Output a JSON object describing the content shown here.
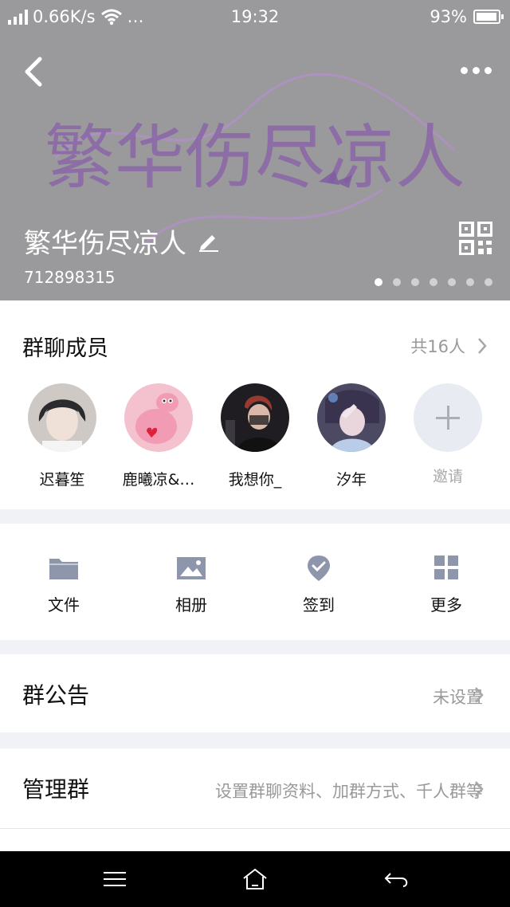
{
  "status_bar": {
    "speed": "0.66K/s",
    "more": "…",
    "time": "19:32",
    "battery": "93%",
    "battery_level": 0.93
  },
  "header": {
    "group_name": "繁华伤尽凉人",
    "group_id": "712898315",
    "cover_text": "繁华伤尽凉人",
    "pager": {
      "total": 7,
      "active": 0
    },
    "colors": {
      "background": "#9a9a9c",
      "cover_art": "#8a66a8"
    }
  },
  "members": {
    "title": "群聊成员",
    "count": "共16人",
    "list": [
      {
        "name": "迟暮笙"
      },
      {
        "name": "鹿曦凉&…"
      },
      {
        "name": "我想你_"
      },
      {
        "name": "汐年"
      }
    ],
    "invite_label": "邀请"
  },
  "tools": [
    {
      "label": "文件",
      "icon": "folder-icon"
    },
    {
      "label": "相册",
      "icon": "image-icon"
    },
    {
      "label": "签到",
      "icon": "location-check-icon"
    },
    {
      "label": "更多",
      "icon": "grid-icon"
    }
  ],
  "notice": {
    "title": "群公告",
    "value": "未设置"
  },
  "manage": {
    "title": "管理群",
    "value": "设置群聊资料、加群方式、千人群等"
  },
  "colors": {
    "icon": "#8e96ab",
    "secondary_text": "#999999",
    "divider": "#f1f2f6"
  }
}
